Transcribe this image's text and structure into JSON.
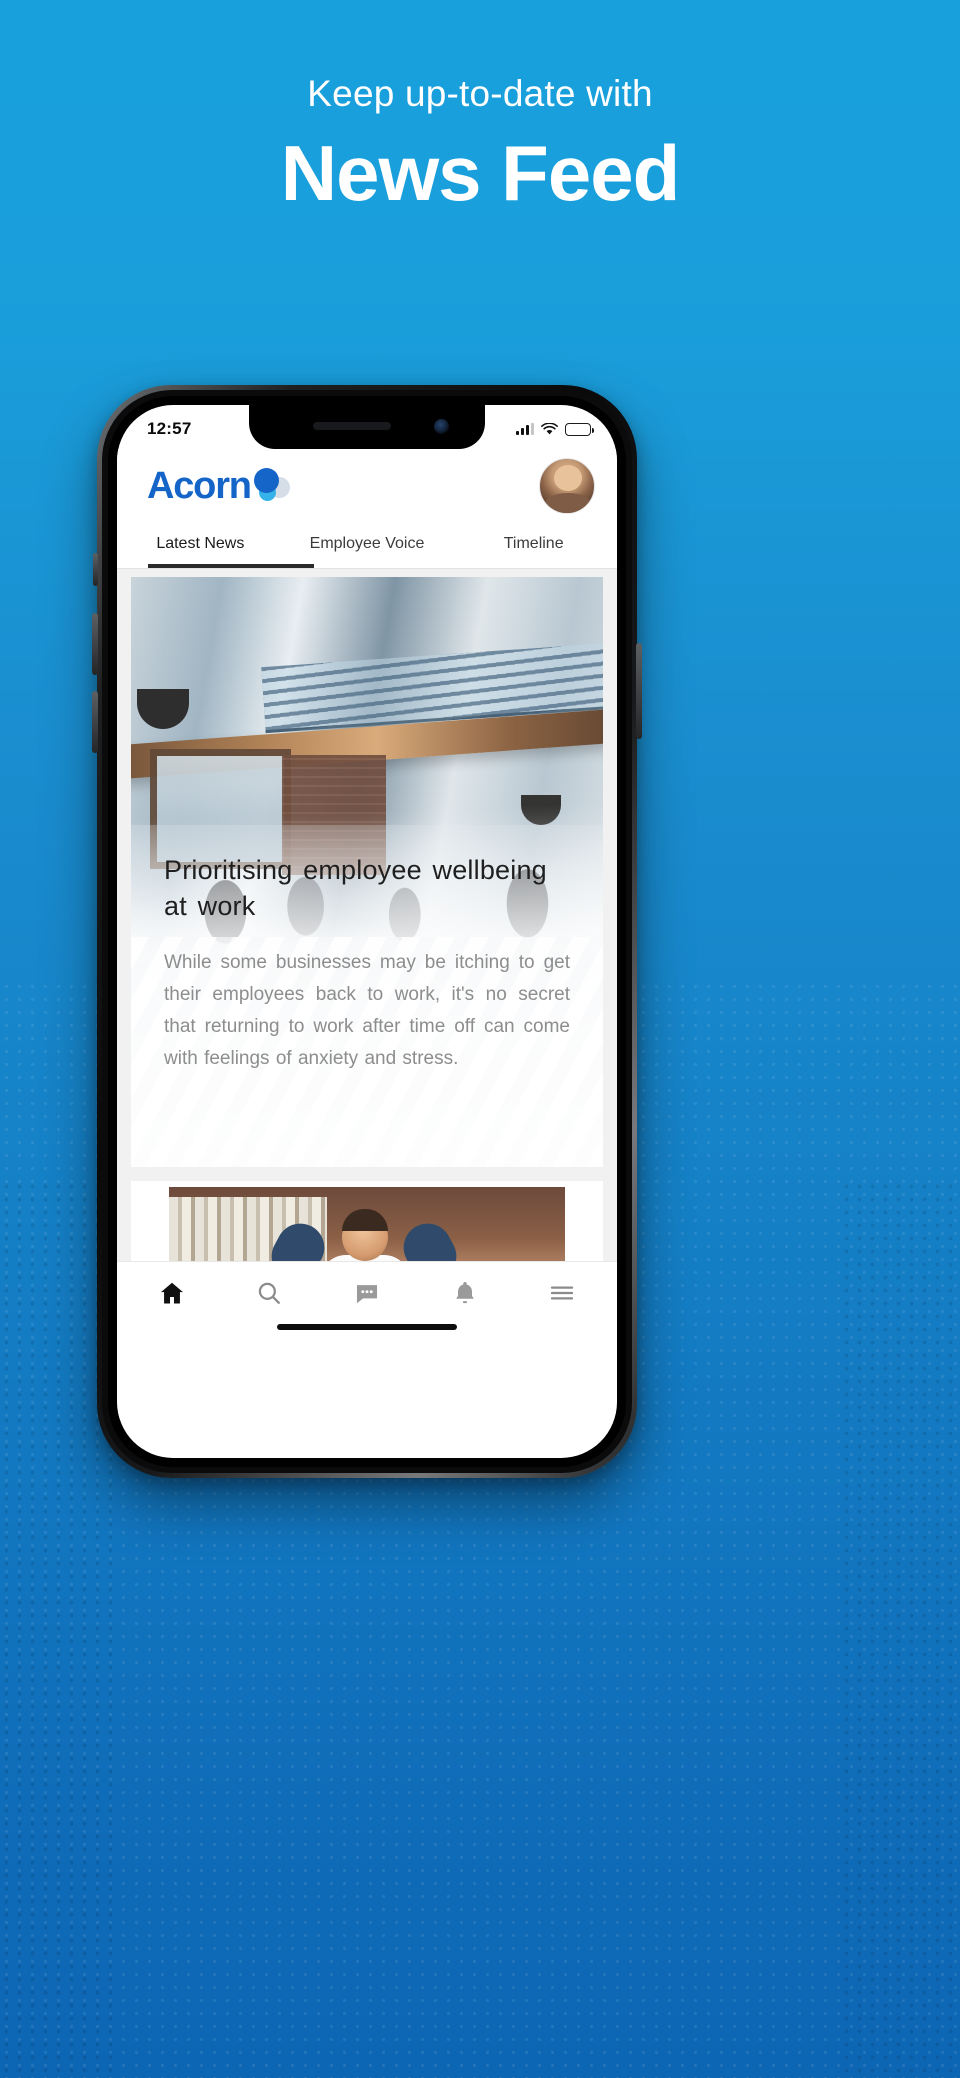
{
  "promo": {
    "eyebrow": "Keep up-to-date with",
    "title": "News Feed",
    "bg_top_color": "#18a0dd",
    "bg_bottom_color": "#0d66b4"
  },
  "phone": {
    "status_bar": {
      "time": "12:57",
      "signal_icon": "signal-bars-icon",
      "wifi_icon": "wifi-icon",
      "battery_icon": "battery-icon",
      "battery_level": "25%"
    },
    "app_header": {
      "brand_name": "Acorn",
      "brand_color": "#1565c8",
      "brand_mark_icon": "acorn-dots-logo-icon",
      "avatar_icon": "user-avatar"
    },
    "tabs": [
      {
        "label": "Latest News",
        "active": true
      },
      {
        "label": "Employee Voice",
        "active": false
      },
      {
        "label": "Timeline",
        "active": false
      }
    ],
    "feed": {
      "articles": [
        {
          "title": "Prioritising employee wellbeing at work",
          "excerpt": "While some businesses may be itching to get their employees back to work, it's no secret that returning to work after time off can come with feelings of anxiety and stress.",
          "image_alt": "open-plan-office-interior"
        },
        {
          "image_alt": "smiling-man-relaxing-at-desk-with-laptop"
        }
      ]
    },
    "bottom_nav": [
      {
        "icon": "home-icon",
        "active": true
      },
      {
        "icon": "search-icon",
        "active": false
      },
      {
        "icon": "chat-bubble-icon",
        "active": false
      },
      {
        "icon": "bell-icon",
        "active": false
      },
      {
        "icon": "hamburger-menu-icon",
        "active": false
      }
    ]
  }
}
